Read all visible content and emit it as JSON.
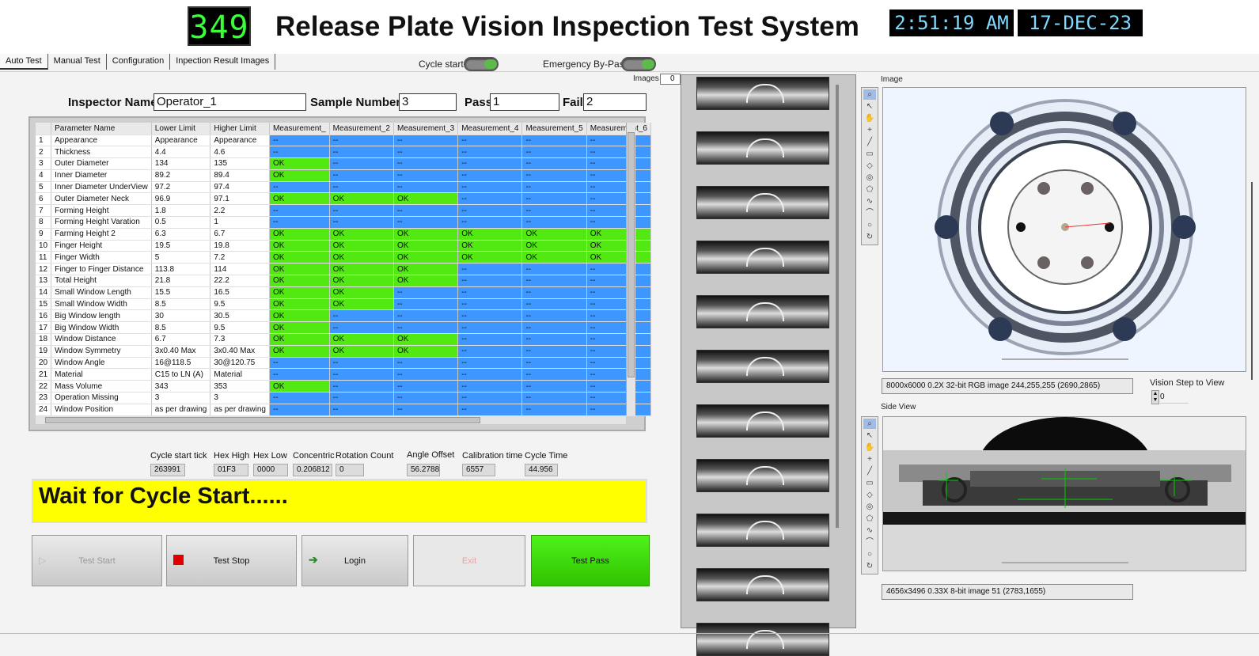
{
  "header": {
    "counter": "349",
    "title": "Release Plate Vision Inspection Test System",
    "time": "2:51:19 AM",
    "date": "17-DEC-23"
  },
  "tabs": [
    "Auto Test",
    "Manual Test",
    "Configuration",
    "Inpection Result Images"
  ],
  "switches": {
    "cycle_start": "Cycle start",
    "emergency_bypass": "Emergency By-Pass"
  },
  "images_ctrl": {
    "label": "Images",
    "value": "0"
  },
  "inspector": {
    "name_label": "Inspector Name",
    "name_value": "Operator_1",
    "sample_label": "Sample Number",
    "sample_value": "3",
    "pass_label": "Pass",
    "pass_value": "1",
    "fail_label": "Fail",
    "fail_value": "2"
  },
  "table": {
    "columns": [
      "",
      "Parameter Name",
      "Lower Limit",
      "Higher Limit",
      "Measurement_",
      "Measurement_2",
      "Measurement_3",
      "Measurement_4",
      "Measurement_5",
      "Measurement_6"
    ],
    "rows": [
      {
        "n": "1",
        "name": "Appearance",
        "lo": "Appearance",
        "hi": "Appearance",
        "m": [
          "--",
          "--",
          "--",
          "--",
          "--",
          "--"
        ],
        "ok": 0
      },
      {
        "n": "2",
        "name": "Thickness",
        "lo": "4.4",
        "hi": "4.6",
        "m": [
          "--",
          "--",
          "--",
          "--",
          "--",
          "--"
        ],
        "ok": 0
      },
      {
        "n": "3",
        "name": "Outer Diameter",
        "lo": "134",
        "hi": "135",
        "m": [
          "OK",
          "--",
          "--",
          "--",
          "--",
          "--"
        ],
        "ok": 1
      },
      {
        "n": "4",
        "name": "Inner Diameter",
        "lo": "89.2",
        "hi": "89.4",
        "m": [
          "OK",
          "--",
          "--",
          "--",
          "--",
          "--"
        ],
        "ok": 1
      },
      {
        "n": "5",
        "name": "Inner Diameter UnderView",
        "lo": "97.2",
        "hi": "97.4",
        "m": [
          "--",
          "--",
          "--",
          "--",
          "--",
          "--"
        ],
        "ok": 0
      },
      {
        "n": "6",
        "name": "Outer Diameter Neck",
        "lo": "96.9",
        "hi": "97.1",
        "m": [
          "OK",
          "OK",
          "OK",
          "--",
          "--",
          "--"
        ],
        "ok": 3
      },
      {
        "n": "7",
        "name": "Forming Height",
        "lo": "1.8",
        "hi": "2.2",
        "m": [
          "--",
          "--",
          "--",
          "--",
          "--",
          "--"
        ],
        "ok": 0
      },
      {
        "n": "8",
        "name": "Forming Height Varation",
        "lo": "0.5",
        "hi": "1",
        "m": [
          "--",
          "--",
          "--",
          "--",
          "--",
          "--"
        ],
        "ok": 0
      },
      {
        "n": "9",
        "name": "Farming Height 2",
        "lo": "6.3",
        "hi": "6.7",
        "m": [
          "OK",
          "OK",
          "OK",
          "OK",
          "OK",
          "OK"
        ],
        "ok": 6
      },
      {
        "n": "10",
        "name": "Finger Height",
        "lo": "19.5",
        "hi": "19.8",
        "m": [
          "OK",
          "OK",
          "OK",
          "OK",
          "OK",
          "OK"
        ],
        "ok": 6
      },
      {
        "n": "11",
        "name": "Finger Width",
        "lo": "5",
        "hi": "7.2",
        "m": [
          "OK",
          "OK",
          "OK",
          "OK",
          "OK",
          "OK"
        ],
        "ok": 6
      },
      {
        "n": "12",
        "name": "Finger to Finger Distance",
        "lo": "113.8",
        "hi": "114",
        "m": [
          "OK",
          "OK",
          "OK",
          "--",
          "--",
          "--"
        ],
        "ok": 3
      },
      {
        "n": "13",
        "name": "Total Height",
        "lo": "21.8",
        "hi": "22.2",
        "m": [
          "OK",
          "OK",
          "OK",
          "--",
          "--",
          "--"
        ],
        "ok": 3
      },
      {
        "n": "14",
        "name": "Small Window Length",
        "lo": "15.5",
        "hi": "16.5",
        "m": [
          "OK",
          "OK",
          "--",
          "--",
          "--",
          "--"
        ],
        "ok": 2
      },
      {
        "n": "15",
        "name": "Small Window Width",
        "lo": "8.5",
        "hi": "9.5",
        "m": [
          "OK",
          "OK",
          "--",
          "--",
          "--",
          "--"
        ],
        "ok": 2
      },
      {
        "n": "16",
        "name": "Big Window length",
        "lo": "30",
        "hi": "30.5",
        "m": [
          "OK",
          "--",
          "--",
          "--",
          "--",
          "--"
        ],
        "ok": 1
      },
      {
        "n": "17",
        "name": "Big Window Width",
        "lo": "8.5",
        "hi": "9.5",
        "m": [
          "OK",
          "--",
          "--",
          "--",
          "--",
          "--"
        ],
        "ok": 1
      },
      {
        "n": "18",
        "name": "Window Distance",
        "lo": "6.7",
        "hi": "7.3",
        "m": [
          "OK",
          "OK",
          "OK",
          "--",
          "--",
          "--"
        ],
        "ok": 3
      },
      {
        "n": "19",
        "name": "Window Symmetry",
        "lo": "3x0.40 Max",
        "hi": "3x0.40 Max",
        "m": [
          "OK",
          "OK",
          "OK",
          "--",
          "--",
          "--"
        ],
        "ok": 3
      },
      {
        "n": "20",
        "name": "Window Angle",
        "lo": "16@118.5",
        "hi": "30@120.75",
        "m": [
          "--",
          "--",
          "--",
          "--",
          "--",
          "--"
        ],
        "ok": 0
      },
      {
        "n": "21",
        "name": "Material",
        "lo": "C15 to LN (A)",
        "hi": "Material",
        "m": [
          "--",
          "--",
          "--",
          "--",
          "--",
          "--"
        ],
        "ok": 0
      },
      {
        "n": "22",
        "name": "Mass Volume",
        "lo": "343",
        "hi": "353",
        "m": [
          "OK",
          "--",
          "--",
          "--",
          "--",
          "--"
        ],
        "ok": 1
      },
      {
        "n": "23",
        "name": "Operation Missing",
        "lo": "3",
        "hi": "3",
        "m": [
          "--",
          "--",
          "--",
          "--",
          "--",
          "--"
        ],
        "ok": 0
      },
      {
        "n": "24",
        "name": "Window Position",
        "lo": "as per drawing",
        "hi": "as per drawing",
        "m": [
          "--",
          "--",
          "--",
          "--",
          "--",
          "--"
        ],
        "ok": 0
      }
    ]
  },
  "stats": [
    {
      "label": "Cycle start tick",
      "value": "263991"
    },
    {
      "label": "Hex High",
      "value": "01F3"
    },
    {
      "label": "Hex Low",
      "value": "0000"
    },
    {
      "label": "Concentric",
      "value": "0.206812"
    },
    {
      "label": "Rotation Count",
      "value": "0"
    },
    {
      "label": "Angle Offset",
      "value": "56.2788"
    },
    {
      "label": "Calibration time",
      "value": "6557"
    },
    {
      "label": "Cycle Time",
      "value": "44.956"
    }
  ],
  "status_message": "Wait for Cycle Start......",
  "buttons": {
    "test_start": "Test Start",
    "test_stop": "Test Stop",
    "login": "Login",
    "exit": "Exit",
    "test_pass": "Test Pass"
  },
  "image_panel": {
    "label": "Image",
    "info": "8000x6000 0.2X 32-bit RGB image 244,255,255    (2690,2865)",
    "vision_step_label": "Vision Step to View",
    "vision_step_value": "0"
  },
  "side_view": {
    "label": "Side View",
    "info": "4656x3496 0.33X 8-bit image 51    (2783,1655)"
  },
  "tool_icons": [
    "zoom-icon",
    "pointer-icon",
    "pan-icon",
    "crosshair-icon",
    "line-icon",
    "rectangle-icon",
    "rotated-rect-icon",
    "annulus-icon",
    "polygon-icon",
    "freehand-icon",
    "broken-line-icon",
    "oval-icon",
    "rotate-icon"
  ],
  "colors": {
    "ok": "#52e812",
    "na": "#3e96ff",
    "banner": "#ffff00",
    "pass": "#2fd600",
    "counter": "#39ff39",
    "clock": "#7fd9ff"
  }
}
